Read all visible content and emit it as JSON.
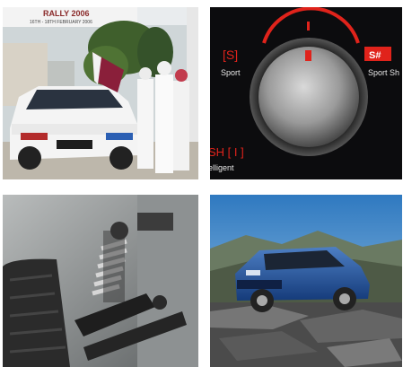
{
  "tiles": {
    "rally": {
      "banner_title": "RALLY 2006",
      "banner_dates": "16TH - 18TH FEBRUARY 2006"
    },
    "dial": {
      "left_badge": "[S]",
      "left_caption": "Sport",
      "right_badge": "S#",
      "right_caption": "Sport Sh",
      "bottom_badge": "SH [ I ]",
      "bottom_caption": "elligent"
    }
  },
  "colors": {
    "dial_red": "#e0231b",
    "sky_blue": "#3a86c8",
    "car_blue": "#1f4f9a",
    "dial_bg": "#0c0c0e"
  }
}
